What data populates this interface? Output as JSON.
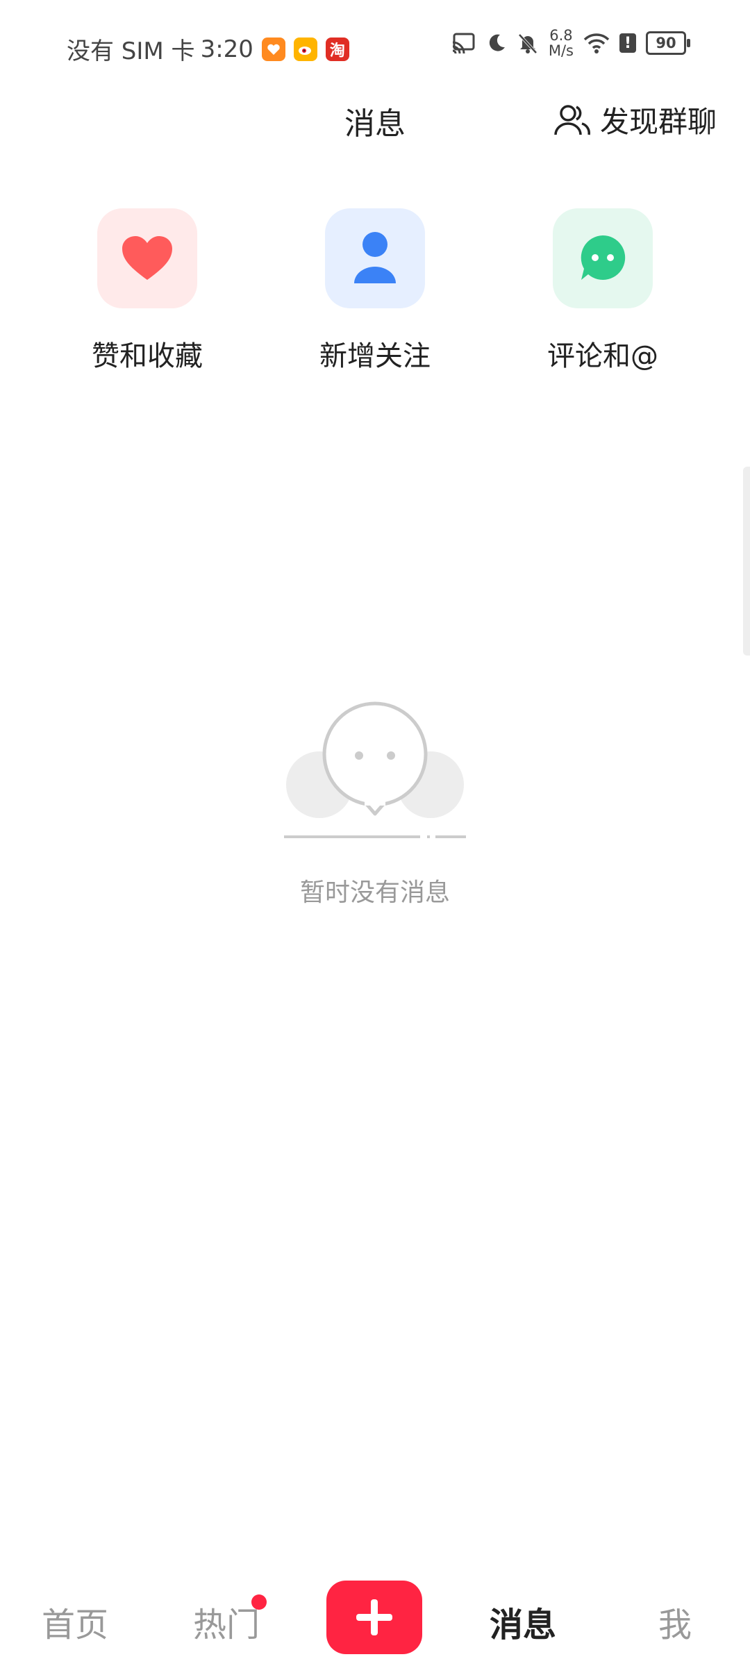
{
  "status_bar": {
    "carrier": "没有 SIM 卡",
    "time": "3:20",
    "speed_value": "6.8",
    "speed_unit": "M/s",
    "battery": "90",
    "app_icons": [
      "taobao-deals-icon",
      "weibo-icon",
      "taobao-icon"
    ],
    "taobao_label": "淘"
  },
  "header": {
    "title": "消息",
    "discover_label": "发现群聊"
  },
  "quick_actions": [
    {
      "label": "赞和收藏",
      "icon": "heart-icon",
      "color": "#ff5b5b",
      "bg": "#ffeaea"
    },
    {
      "label": "新增关注",
      "icon": "user-icon",
      "color": "#3b82f6",
      "bg": "#e6efff"
    },
    {
      "label": "评论和@",
      "icon": "chat-bubble-icon",
      "color": "#2ecc8a",
      "bg": "#e5f8ef"
    }
  ],
  "empty_state": {
    "text": "暂时没有消息"
  },
  "bottom_nav": {
    "home": "首页",
    "hot": "热门",
    "messages": "消息",
    "me": "我",
    "active": "messages",
    "hot_badge": true
  },
  "colors": {
    "brand": "#ff2442",
    "text_primary": "#222222",
    "text_muted": "#999999"
  }
}
